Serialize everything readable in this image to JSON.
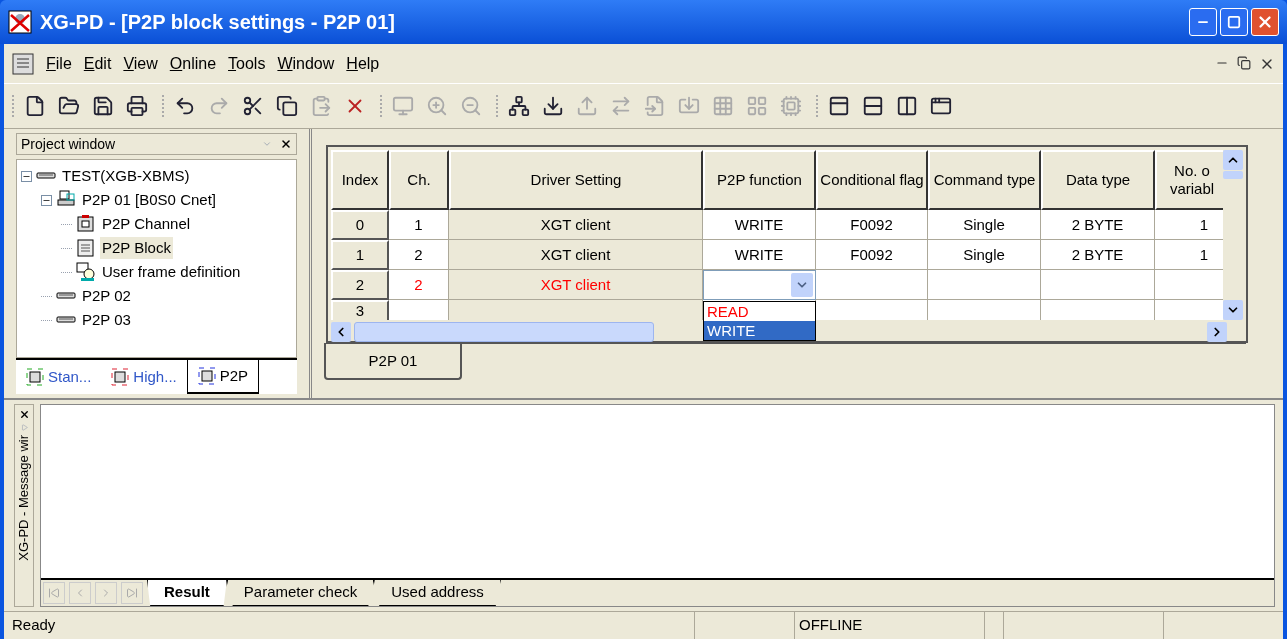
{
  "window": {
    "title": "XG-PD - [P2P block settings - P2P 01]"
  },
  "menu": [
    "File",
    "Edit",
    "View",
    "Online",
    "Tools",
    "Window",
    "Help"
  ],
  "toolbar": [
    [
      {
        "kind": "new",
        "disabled": false
      },
      {
        "kind": "open",
        "disabled": false
      },
      {
        "kind": "save",
        "disabled": false
      },
      {
        "kind": "print",
        "disabled": false
      }
    ],
    [
      {
        "kind": "undo",
        "disabled": false
      },
      {
        "kind": "redo",
        "disabled": true
      },
      {
        "kind": "cut",
        "disabled": false
      },
      {
        "kind": "copy",
        "disabled": false
      },
      {
        "kind": "paste",
        "disabled": true
      },
      {
        "kind": "delete",
        "disabled": false
      }
    ],
    [
      {
        "kind": "monitor",
        "disabled": true
      },
      {
        "kind": "zoomin",
        "disabled": true
      },
      {
        "kind": "zoomout",
        "disabled": true
      }
    ],
    [
      {
        "kind": "network",
        "disabled": false
      },
      {
        "kind": "download",
        "disabled": false
      },
      {
        "kind": "upload",
        "disabled": true
      },
      {
        "kind": "transfer",
        "disabled": true
      },
      {
        "kind": "input",
        "disabled": true
      },
      {
        "kind": "import",
        "disabled": true
      },
      {
        "kind": "grid",
        "disabled": true
      },
      {
        "kind": "layout",
        "disabled": true
      },
      {
        "kind": "chip",
        "disabled": true
      }
    ],
    [
      {
        "kind": "cascade",
        "disabled": false
      },
      {
        "kind": "rows",
        "disabled": false
      },
      {
        "kind": "columns",
        "disabled": false
      },
      {
        "kind": "windows",
        "disabled": false
      }
    ]
  ],
  "project_window": {
    "title": "Project window",
    "tree": [
      {
        "label": "TEST(XGB-XBMS)",
        "kind": "station",
        "expanded": true,
        "selected": false,
        "children": [
          {
            "label": "P2P 01 [B0S0 Cnet]",
            "kind": "network",
            "expanded": true,
            "selected": false,
            "children": [
              {
                "label": "P2P Channel",
                "kind": "channel",
                "selected": false
              },
              {
                "label": "P2P Block",
                "kind": "block",
                "selected": true
              },
              {
                "label": "User frame definition",
                "kind": "frame",
                "selected": false
              }
            ]
          },
          {
            "label": "P2P 02",
            "kind": "station",
            "selected": false
          },
          {
            "label": "P2P 03",
            "kind": "station",
            "selected": false
          }
        ]
      }
    ],
    "tabs": [
      {
        "label": "Stan...",
        "kind": "standard",
        "selected": false
      },
      {
        "label": "High...",
        "kind": "high",
        "selected": false
      },
      {
        "label": "P2P",
        "kind": "p2p",
        "selected": true
      }
    ]
  },
  "table": {
    "columns": [
      "Index",
      "Ch.",
      "Driver Setting",
      "P2P function",
      "Conditional flag",
      "Command type",
      "Data type",
      "No. o\nvariabl"
    ],
    "rows": [
      {
        "invalid": false,
        "cells": [
          "0",
          "1",
          "XGT client",
          "WRITE",
          "F0092",
          "Single",
          "2 BYTE",
          "1"
        ]
      },
      {
        "invalid": false,
        "cells": [
          "1",
          "2",
          "XGT client",
          "WRITE",
          "F0092",
          "Single",
          "2 BYTE",
          "1"
        ]
      },
      {
        "invalid": true,
        "cells": [
          "2",
          "2",
          "XGT client",
          null,
          null,
          null,
          null,
          null
        ],
        "dropdown": {
          "options": [
            {
              "label": "READ",
              "selected": false
            },
            {
              "label": "WRITE",
              "selected": true
            }
          ]
        }
      },
      {
        "cells": [
          "3",
          null,
          null,
          null,
          null,
          null,
          null,
          null
        ]
      }
    ]
  },
  "doc_tabs": [
    {
      "label": "P2P 01",
      "selected": true
    }
  ],
  "message_window": {
    "title": "XG-PD - Message wir",
    "tabs": [
      {
        "label": "Result",
        "selected": true
      },
      {
        "label": "Parameter check",
        "selected": false
      },
      {
        "label": "Used address",
        "selected": false
      }
    ]
  },
  "status_bar": {
    "message": "Ready",
    "mode": "OFFLINE"
  }
}
